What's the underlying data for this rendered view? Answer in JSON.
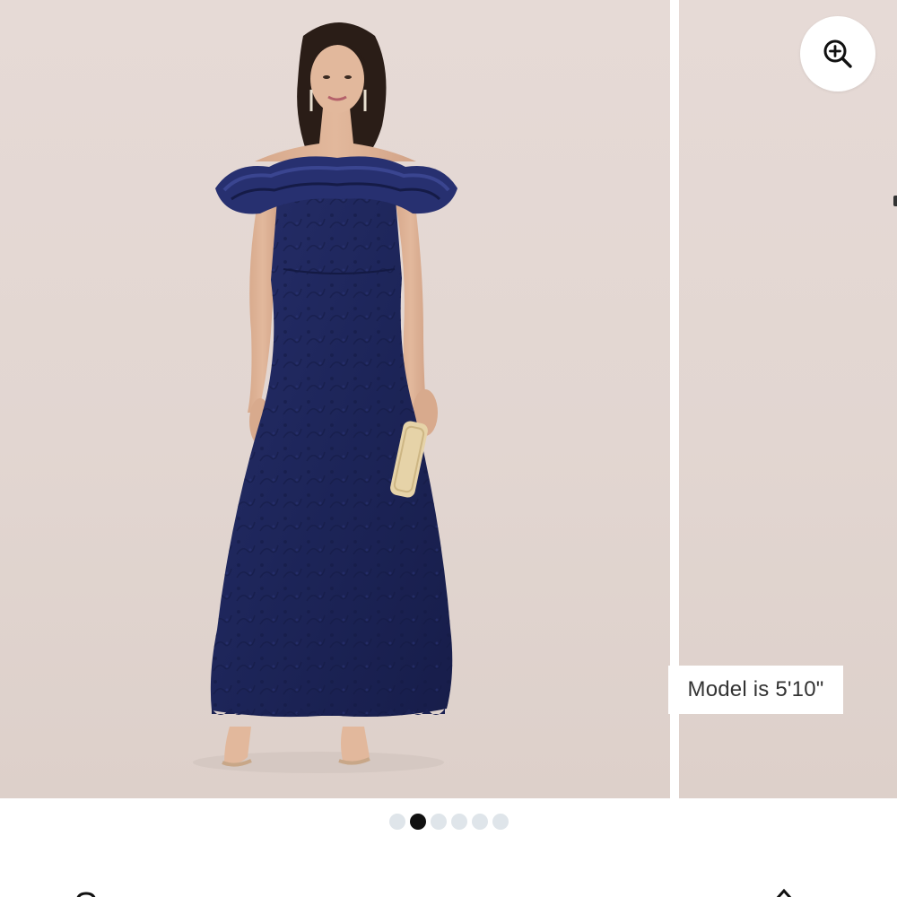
{
  "product_gallery": {
    "model_height_label": "Model is 5'10\"",
    "slide_count": 6,
    "active_slide": 2
  },
  "icons": {
    "zoom": "zoom-in-icon",
    "toolbar_left": "chat-icon",
    "toolbar_right": "share-icon"
  },
  "colors": {
    "background": "#e4d8d3",
    "dress": "#1c2459",
    "dot_active": "#111111",
    "dot_inactive": "#dfe5ea"
  }
}
